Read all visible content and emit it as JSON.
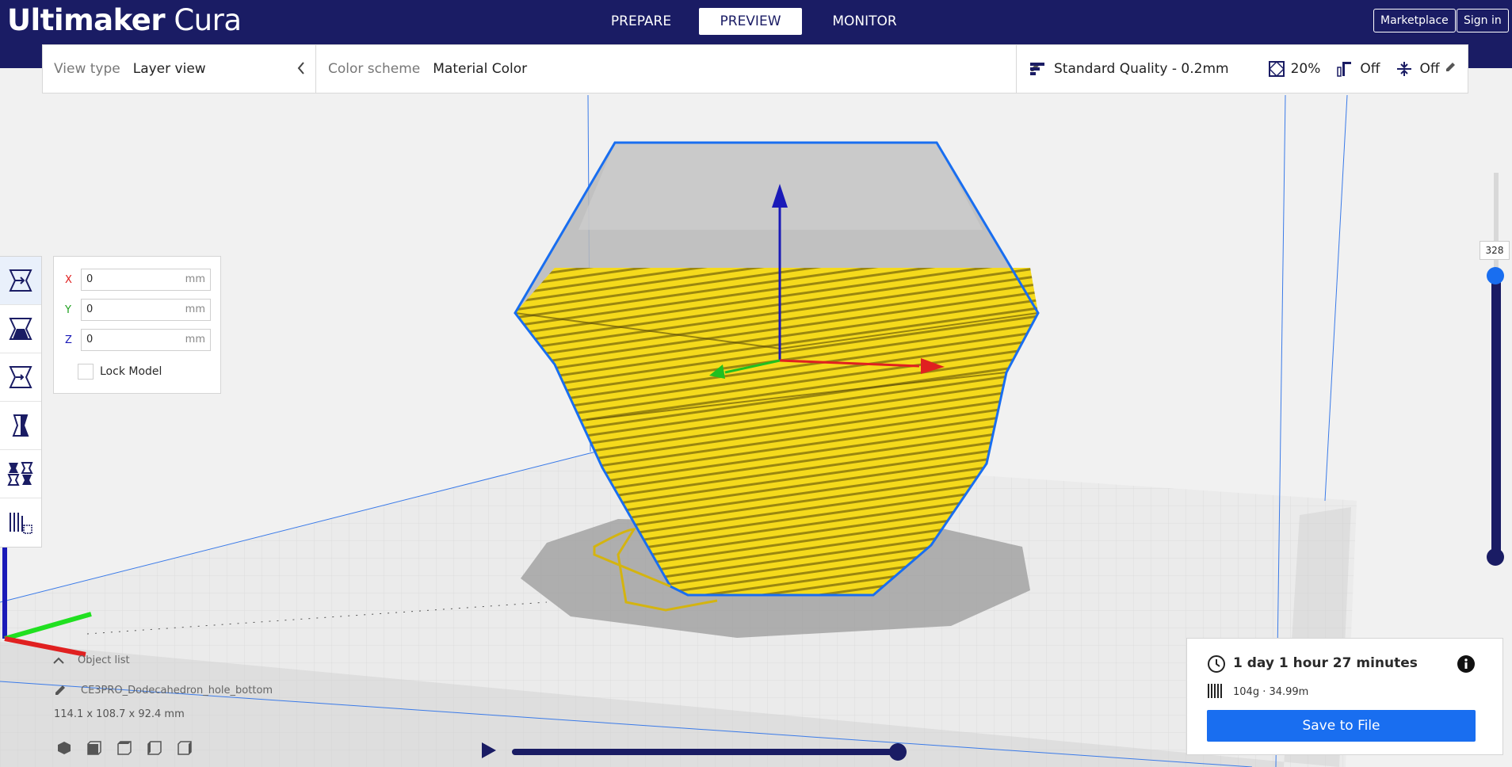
{
  "app": {
    "logo_bold": "Ultimaker",
    "logo_light": " Cura"
  },
  "stages": [
    {
      "label": "PREPARE",
      "active": false
    },
    {
      "label": "PREVIEW",
      "active": true
    },
    {
      "label": "MONITOR",
      "active": false
    }
  ],
  "topbar": {
    "marketplace": "Marketplace",
    "signin": "Sign in"
  },
  "header": {
    "view_type_label": "View type",
    "view_type_value": "Layer view",
    "color_scheme_label": "Color scheme",
    "color_scheme_value": "Material Color",
    "quality": "Standard Quality - 0.2mm",
    "infill": "20%",
    "support": "Off",
    "adhesion": "Off"
  },
  "move_panel": {
    "x_label": "X",
    "x_value": "0",
    "y_label": "Y",
    "y_value": "0",
    "z_label": "Z",
    "z_value": "0",
    "unit": "mm",
    "lock_label": "Lock Model"
  },
  "object_list": {
    "toggle_label": "Object list",
    "object_name": "CE3PRO_Dodecahedron_hole_bottom",
    "dimensions": "114.1 x 108.7 x 92.4 mm"
  },
  "print_info": {
    "time": "1 day 1 hour 27 minutes",
    "material": "104g · 34.99m",
    "save_label": "Save to File"
  },
  "layer_slider": {
    "current_layer": "328"
  },
  "colors": {
    "topbar": "#1a1c64",
    "accent": "#196ef0",
    "model_yellow": "#f5dc1e",
    "axis_x": "#e02020",
    "axis_y": "#20c020",
    "axis_z": "#1a1ab8"
  },
  "icons": [
    "clock-icon",
    "info-icon",
    "filament-icon",
    "pencil-icon",
    "play-icon",
    "quality-icon",
    "infill-icon",
    "support-icon",
    "adhesion-icon",
    "chevron-left-icon",
    "chevron-up-icon"
  ]
}
